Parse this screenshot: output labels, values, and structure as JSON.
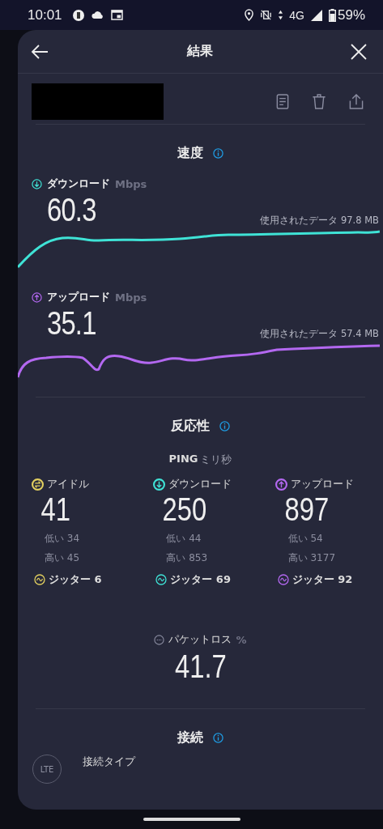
{
  "status_bar": {
    "time": "10:01",
    "network": "4G",
    "battery": "59%"
  },
  "header": {
    "title": "結果"
  },
  "speed": {
    "title": "速度",
    "tests": [
      {
        "kind": "download",
        "label": "ダウンロード",
        "unit": "Mbps",
        "value": "60.3",
        "data_used": "使用されたデータ 97.8 MB",
        "color": "#3fe3d6"
      },
      {
        "kind": "upload",
        "label": "アップロード",
        "unit": "Mbps",
        "value": "35.1",
        "data_used": "使用されたデータ 57.4 MB",
        "color": "#b368f0"
      }
    ]
  },
  "responsiveness": {
    "title": "反応性",
    "ping_label": "PING",
    "ping_unit": "ミリ秒",
    "columns": [
      {
        "kind": "idle",
        "label": "アイドル",
        "value": "41",
        "low": "低い 34",
        "high": "高い 45",
        "jitter": "ジッター 6",
        "color": "#e2cf5f"
      },
      {
        "kind": "download",
        "label": "ダウンロード",
        "value": "250",
        "low": "低い 44",
        "high": "高い 853",
        "jitter": "ジッター 69",
        "color": "#3fe3d6"
      },
      {
        "kind": "upload",
        "label": "アップロード",
        "value": "897",
        "low": "低い 54",
        "high": "高い 3177",
        "jitter": "ジッター 92",
        "color": "#b368f0"
      }
    ],
    "packet_loss": {
      "label": "パケットロス",
      "unit": "%",
      "value": "41.7"
    }
  },
  "connection": {
    "title": "接続",
    "rows": [
      {
        "label": "接続タイプ",
        "badge": "LTE"
      }
    ]
  }
}
